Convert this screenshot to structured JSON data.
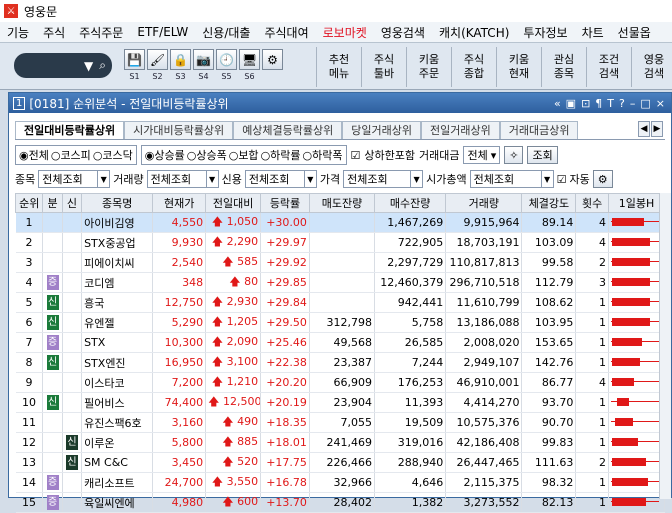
{
  "app": {
    "title": "영웅문"
  },
  "menu": [
    "기능",
    "주식",
    "주식주문",
    "ETF/ELW",
    "신용/대출",
    "주식대여",
    "로보마켓",
    "영웅검색",
    "캐치(KATCH)",
    "투자정보",
    "차트",
    "선물옵"
  ],
  "menu_highlight_index": 6,
  "toolbar": {
    "icons": [
      "save-icon",
      "brush-icon",
      "lock-icon",
      "camera-icon",
      "clock-icon",
      "monitor-icon",
      "gear-icon"
    ],
    "slot_labels": [
      "S1",
      "S2",
      "S3",
      "S4",
      "S5",
      "S6"
    ],
    "big_buttons": [
      [
        "추천",
        "메뉴"
      ],
      [
        "주식",
        "툴바"
      ],
      [
        "키움",
        "주문"
      ],
      [
        "주식",
        "종합"
      ],
      [
        "키움",
        "현재"
      ],
      [
        "관심",
        "종목"
      ],
      [
        "조건",
        "검색"
      ],
      [
        "영웅",
        "검색"
      ]
    ]
  },
  "window": {
    "number": "1",
    "title": "[0181] 순위분석 - 전일대비등락률상위",
    "controls": [
      "«",
      "▣",
      "⊡",
      "¶",
      "T",
      "?",
      "–",
      "□",
      "×"
    ]
  },
  "tabs": [
    "전일대비등락률상위",
    "시가대비등락률상위",
    "예상체결등락률상위",
    "당일거래상위",
    "전일거래상위",
    "거래대금상위"
  ],
  "active_tab": 0,
  "market_radios": [
    "전체",
    "코스피",
    "코스닥"
  ],
  "market_selected": 0,
  "type_radios": [
    "상승률",
    "상승폭",
    "보합",
    "하락률",
    "하락폭"
  ],
  "type_selected": 0,
  "include_limit": {
    "label": "상하한포함",
    "checked": true
  },
  "trade_value": {
    "label": "거래대금",
    "value": "전체"
  },
  "query_button": "조회",
  "filters": [
    {
      "label": "종목",
      "value": "전체조회"
    },
    {
      "label": "거래량",
      "value": "전체조회"
    },
    {
      "label": "신용",
      "value": "전체조회"
    },
    {
      "label": "가격",
      "value": "전체조회"
    },
    {
      "label": "시가총액",
      "value": "전체조회"
    }
  ],
  "auto": {
    "label": "자동",
    "checked": true
  },
  "columns": [
    "순위",
    "분",
    "신",
    "종목명",
    "현재가",
    "전일대비",
    "등락률",
    "매도잔량",
    "매수잔량",
    "거래량",
    "체결강도",
    "횟수",
    "1일봉H"
  ],
  "rows": [
    {
      "rank": "1",
      "b": "",
      "s": "",
      "name": "아이비김영",
      "price": "4,550",
      "diff": "1,050",
      "rate": "+30.00",
      "sell": "",
      "buy": "1,467,269",
      "vol": "9,915,964",
      "str": "89.14",
      "cnt": "4",
      "bar": [
        3,
        32
      ]
    },
    {
      "rank": "2",
      "b": "",
      "s": "",
      "name": "STX중공업",
      "price": "9,930",
      "diff": "2,290",
      "rate": "+29.97",
      "sell": "",
      "buy": "722,905",
      "vol": "18,703,191",
      "str": "103.09",
      "cnt": "4",
      "bar": [
        3,
        38
      ]
    },
    {
      "rank": "3",
      "b": "",
      "s": "",
      "name": "피에이치씨",
      "price": "2,540",
      "diff": "585",
      "rate": "+29.92",
      "sell": "",
      "buy": "2,297,729",
      "vol": "110,817,813",
      "str": "99.58",
      "cnt": "2",
      "bar": [
        3,
        38
      ]
    },
    {
      "rank": "4",
      "b": "증",
      "s": "",
      "name": "코디엠",
      "price": "348",
      "diff": "80",
      "rate": "+29.85",
      "sell": "",
      "buy": "12,460,379",
      "vol": "296,710,518",
      "str": "112.79",
      "cnt": "3",
      "bar": [
        3,
        38
      ]
    },
    {
      "rank": "5",
      "b": "신",
      "s": "",
      "name": "흥국",
      "price": "12,750",
      "diff": "2,930",
      "rate": "+29.84",
      "sell": "",
      "buy": "942,441",
      "vol": "11,610,799",
      "str": "108.62",
      "cnt": "1",
      "bar": [
        3,
        38
      ]
    },
    {
      "rank": "6",
      "b": "신",
      "s": "",
      "name": "유엔젤",
      "price": "5,290",
      "diff": "1,205",
      "rate": "+29.50",
      "sell": "312,798",
      "buy": "5,758",
      "vol": "13,186,088",
      "str": "103.95",
      "cnt": "1",
      "bar": [
        3,
        38
      ]
    },
    {
      "rank": "7",
      "b": "증",
      "s": "",
      "name": "STX",
      "price": "10,300",
      "diff": "2,090",
      "rate": "+25.46",
      "sell": "49,568",
      "buy": "26,585",
      "vol": "2,008,020",
      "str": "153.65",
      "cnt": "1",
      "bar": [
        3,
        30
      ]
    },
    {
      "rank": "8",
      "b": "신",
      "s": "",
      "name": "STX엔진",
      "price": "16,950",
      "diff": "3,100",
      "rate": "+22.38",
      "sell": "23,387",
      "buy": "7,244",
      "vol": "2,949,107",
      "str": "142.76",
      "cnt": "1",
      "bar": [
        3,
        28
      ]
    },
    {
      "rank": "9",
      "b": "",
      "s": "",
      "name": "이스타코",
      "price": "7,200",
      "diff": "1,210",
      "rate": "+20.20",
      "sell": "66,909",
      "buy": "176,253",
      "vol": "46,910,001",
      "str": "86.77",
      "cnt": "4",
      "bar": [
        3,
        22
      ]
    },
    {
      "rank": "10",
      "b": "신",
      "s": "",
      "name": "필어비스",
      "price": "74,400",
      "diff": "12,500",
      "rate": "+20.19",
      "sell": "23,904",
      "buy": "11,393",
      "vol": "4,414,270",
      "str": "93.70",
      "cnt": "1",
      "bar": [
        8,
        12
      ]
    },
    {
      "rank": "11",
      "b": "",
      "s": "",
      "name": "유진스팩6호",
      "price": "3,160",
      "diff": "490",
      "rate": "+18.35",
      "sell": "7,055",
      "buy": "19,509",
      "vol": "10,575,376",
      "str": "90.70",
      "cnt": "1",
      "bar": [
        6,
        18
      ]
    },
    {
      "rank": "12",
      "b": "",
      "s": "신",
      "name": "이루온",
      "price": "5,800",
      "diff": "885",
      "rate": "+18.01",
      "sell": "241,469",
      "buy": "319,016",
      "vol": "42,186,408",
      "str": "99.83",
      "cnt": "1",
      "bar": [
        3,
        26
      ]
    },
    {
      "rank": "13",
      "b": "",
      "s": "신",
      "name": "SM C&C",
      "price": "3,450",
      "diff": "520",
      "rate": "+17.75",
      "sell": "226,466",
      "buy": "288,940",
      "vol": "26,447,465",
      "str": "111.63",
      "cnt": "2",
      "bar": [
        3,
        34
      ]
    },
    {
      "rank": "14",
      "b": "증",
      "s": "",
      "name": "캐리소프트",
      "price": "24,700",
      "diff": "3,550",
      "rate": "+16.78",
      "sell": "32,966",
      "buy": "4,646",
      "vol": "2,115,375",
      "str": "98.32",
      "cnt": "1",
      "bar": [
        3,
        36
      ]
    },
    {
      "rank": "15",
      "b": "증",
      "s": "",
      "name": "육일씨엔에",
      "price": "4,980",
      "diff": "600",
      "rate": "+13.70",
      "sell": "28,402",
      "buy": "1,382",
      "vol": "3,273,552",
      "str": "82.13",
      "cnt": "1",
      "bar": [
        3,
        34
      ]
    }
  ],
  "colors": {
    "up": "#e01818",
    "selected_row": "#cfe4fa",
    "title_bar": "#2e5f9e"
  }
}
